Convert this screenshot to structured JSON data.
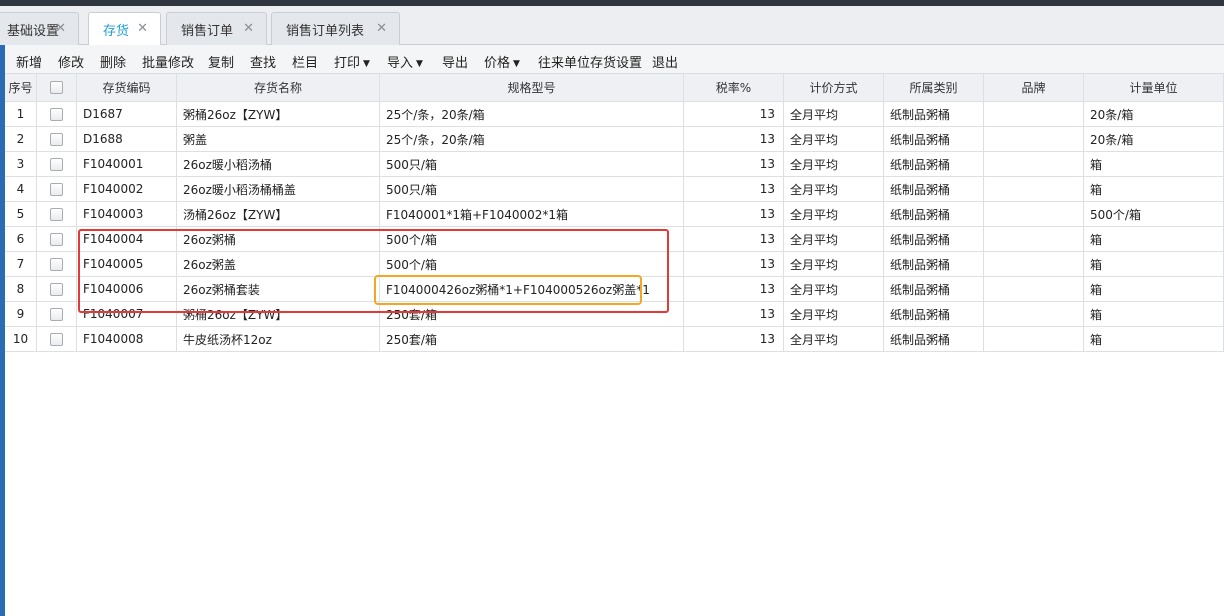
{
  "tabs": [
    {
      "label": "基础设置",
      "active": false
    },
    {
      "label": "存货",
      "active": true
    },
    {
      "label": "销售订单",
      "active": false
    },
    {
      "label": "销售订单列表",
      "active": false
    }
  ],
  "close_glyph": "✕",
  "toolbar": {
    "items": [
      "新增",
      "修改",
      "删除",
      "批量修改",
      "复制",
      "查找",
      "栏目",
      "打印",
      "导入",
      "导出",
      "价格",
      "往来单位存货设置",
      "退出"
    ],
    "dropdown_caret": "▼"
  },
  "table": {
    "headers": [
      "序号",
      "",
      "存货编码",
      "存货名称",
      "规格型号",
      "税率%",
      "计价方式",
      "所属类别",
      "品牌",
      "计量单位"
    ],
    "rows": [
      [
        "1",
        "",
        "D1687",
        "粥桶26oz【ZYW】",
        "25个/条，20条/箱",
        "13",
        "全月平均",
        "纸制品粥桶",
        "",
        "20条/箱"
      ],
      [
        "2",
        "",
        "D1688",
        "粥盖",
        "25个/条，20条/箱",
        "13",
        "全月平均",
        "纸制品粥桶",
        "",
        "20条/箱"
      ],
      [
        "3",
        "",
        "F1040001",
        "26oz暖小稻汤桶",
        "500只/箱",
        "13",
        "全月平均",
        "纸制品粥桶",
        "",
        "箱"
      ],
      [
        "4",
        "",
        "F1040002",
        "26oz暖小稻汤桶桶盖",
        "500只/箱",
        "13",
        "全月平均",
        "纸制品粥桶",
        "",
        "箱"
      ],
      [
        "5",
        "",
        "F1040003",
        "汤桶26oz【ZYW】",
        "F1040001*1箱+F1040002*1箱",
        "13",
        "全月平均",
        "纸制品粥桶",
        "",
        "500个/箱"
      ],
      [
        "6",
        "",
        "F1040004",
        "26oz粥桶",
        "500个/箱",
        "13",
        "全月平均",
        "纸制品粥桶",
        "",
        "箱"
      ],
      [
        "7",
        "",
        "F1040005",
        "26oz粥盖",
        "500个/箱",
        "13",
        "全月平均",
        "纸制品粥桶",
        "",
        "箱"
      ],
      [
        "8",
        "",
        "F1040006",
        "26oz粥桶套装",
        "F104000426oz粥桶*1+F104000526oz粥盖*1",
        "13",
        "全月平均",
        "纸制品粥桶",
        "",
        "箱"
      ],
      [
        "9",
        "",
        "F1040007",
        "粥桶26oz【ZYW】",
        "250套/箱",
        "13",
        "全月平均",
        "纸制品粥桶",
        "",
        "箱"
      ],
      [
        "10",
        "",
        "F1040008",
        "牛皮纸汤杯12oz",
        "250套/箱",
        "13",
        "全月平均",
        "纸制品粥桶",
        "",
        "箱"
      ]
    ]
  },
  "colors": {
    "active_tab_text": "#1f9fd8",
    "left_rail": "#2a6bb5",
    "highlight_red": "#e53935",
    "highlight_orange": "#f5a623"
  }
}
